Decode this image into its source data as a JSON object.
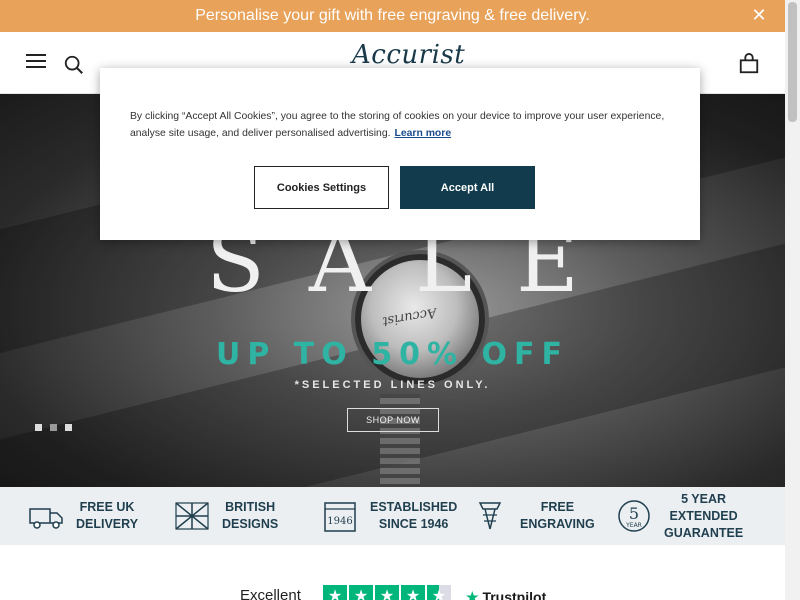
{
  "promo": {
    "text": "Personalise your gift with free engraving & free delivery."
  },
  "header": {
    "logo": "Accurist"
  },
  "hero": {
    "headline": "SALE",
    "offer": "UP TO 50% OFF",
    "note": "*SELECTED LINES ONLY.",
    "cta": "SHOP NOW",
    "watch_brand": "Accurist",
    "slides": 3,
    "active_slide": 2
  },
  "cookie": {
    "text": "By clicking “Accept All Cookies”, you agree to the storing of cookies on your device to improve your user experience, analyse site usage, and deliver personalised advertising.",
    "learn_more": "Learn more",
    "settings_label": "Cookies Settings",
    "accept_label": "Accept All"
  },
  "features": [
    {
      "line1": "FREE UK",
      "line2": "DELIVERY",
      "icon": "truck-icon"
    },
    {
      "line1": "BRITISH",
      "line2": "DESIGNS",
      "icon": "union-flag-icon"
    },
    {
      "line1": "ESTABLISHED",
      "line2": "SINCE 1946",
      "icon": "calendar-icon",
      "icon_text": "1946"
    },
    {
      "line1": "FREE",
      "line2": "ENGRAVING",
      "icon": "engraving-icon"
    },
    {
      "line1": "5 YEAR",
      "line2": "EXTENDED",
      "line3": "GUARANTEE",
      "icon": "guarantee-icon",
      "icon_text": "5",
      "icon_sub": "YEAR"
    }
  ],
  "trust": {
    "rating_text": "Excellent",
    "stars": 4.5,
    "brand": "Trustpilot"
  },
  "colors": {
    "promo": "#e8a25a",
    "accent": "#2fb3a3",
    "accept": "#123c4d",
    "trust_green": "#00b67a",
    "feature_text": "#1f3f4f"
  }
}
